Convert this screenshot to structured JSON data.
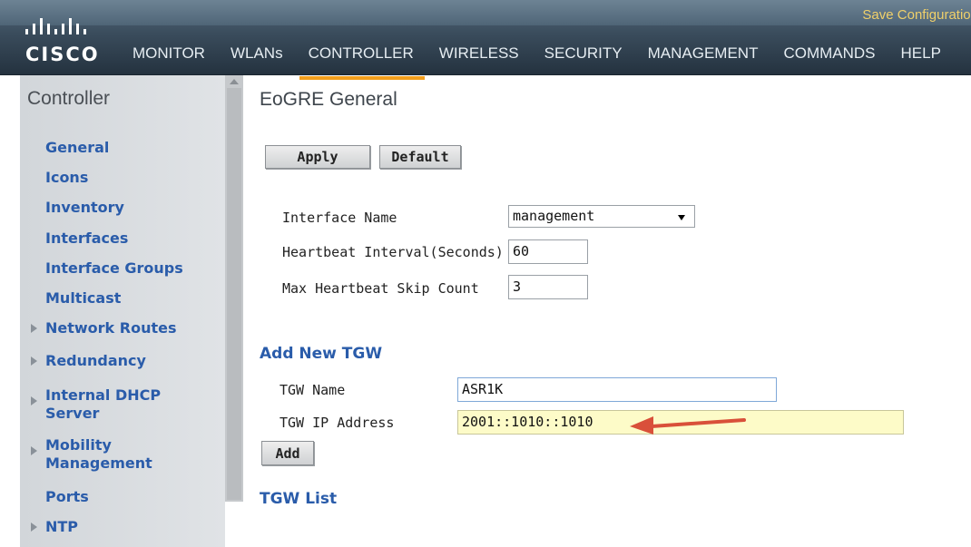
{
  "header": {
    "logo_text": "CISCO",
    "save_label": "Save Configuration",
    "nav": [
      {
        "label": "MONITOR",
        "active": false
      },
      {
        "label": "WLANs",
        "active": false
      },
      {
        "label": "CONTROLLER",
        "active": true
      },
      {
        "label": "WIRELESS",
        "active": false
      },
      {
        "label": "SECURITY",
        "active": false
      },
      {
        "label": "MANAGEMENT",
        "active": false
      },
      {
        "label": "COMMANDS",
        "active": false
      },
      {
        "label": "HELP",
        "active": false
      }
    ]
  },
  "sidebar": {
    "title": "Controller",
    "items": [
      {
        "label": "General",
        "expandable": false
      },
      {
        "label": "Icons",
        "expandable": false
      },
      {
        "label": "Inventory",
        "expandable": false
      },
      {
        "label": "Interfaces",
        "expandable": false
      },
      {
        "label": "Interface Groups",
        "expandable": false
      },
      {
        "label": "Multicast",
        "expandable": false
      },
      {
        "label": "Network Routes",
        "expandable": true
      },
      {
        "label": "Redundancy",
        "expandable": true
      },
      {
        "label": "Internal DHCP",
        "label2": "Server",
        "expandable": true
      },
      {
        "label": "Mobility",
        "label2": "Management",
        "expandable": true
      },
      {
        "label": "Ports",
        "expandable": false
      },
      {
        "label": "NTP",
        "expandable": true
      }
    ]
  },
  "main": {
    "title": "EoGRE General",
    "apply_label": "Apply",
    "default_label": "Default",
    "interface_name_label": "Interface Name",
    "interface_name_value": "management",
    "heartbeat_label": "Heartbeat Interval(Seconds)",
    "heartbeat_value": "60",
    "skip_count_label": "Max Heartbeat Skip Count",
    "skip_count_value": "3",
    "add_tgw_heading": "Add New TGW",
    "tgw_name_label": "TGW Name",
    "tgw_name_value": "ASR1K",
    "tgw_ip_label": "TGW IP Address",
    "tgw_ip_value": "2001::1010::1010",
    "add_label": "Add",
    "tgw_list_heading": "TGW List"
  },
  "colors": {
    "link_blue": "#2a5caa",
    "active_tab": "#f29e1c",
    "highlight_field": "#fdfbc8",
    "annotation_arrow": "#d9503a"
  }
}
